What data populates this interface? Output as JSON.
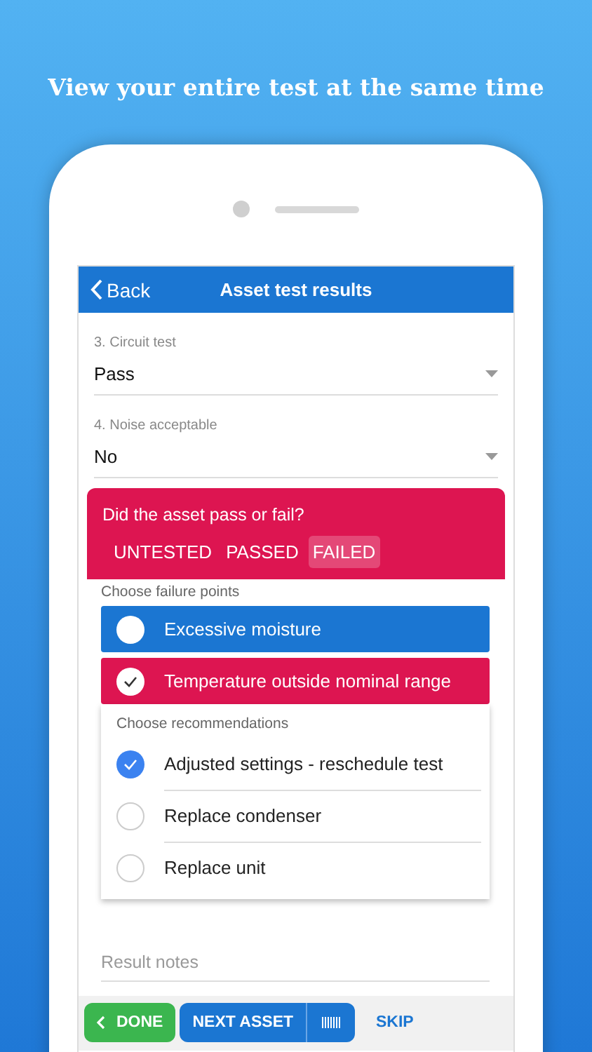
{
  "headline": "View your entire test at the same time",
  "header": {
    "back": "Back",
    "title": "Asset test results"
  },
  "fields": [
    {
      "label": "3. Circuit test",
      "value": "Pass"
    },
    {
      "label": "4. Noise acceptable",
      "value": "No"
    }
  ],
  "result_card": {
    "question": "Did the asset pass or fail?",
    "options": [
      {
        "label": "UNTESTED",
        "selected": false
      },
      {
        "label": "PASSED",
        "selected": false
      },
      {
        "label": "FAILED",
        "selected": true
      }
    ]
  },
  "failure_points": {
    "label": "Choose failure points",
    "items": [
      {
        "label": "Excessive moisture",
        "checked": false
      },
      {
        "label": "Temperature outside nominal range",
        "checked": true
      }
    ]
  },
  "recommendations": {
    "label": "Choose recommendations",
    "items": [
      {
        "label": "Adjusted settings - reschedule test",
        "checked": true
      },
      {
        "label": "Replace condenser",
        "checked": false
      },
      {
        "label": "Replace unit",
        "checked": false
      }
    ]
  },
  "notes": {
    "placeholder": "Result notes"
  },
  "actions": {
    "done": "DONE",
    "next": "NEXT ASSET",
    "skip": "SKIP"
  }
}
